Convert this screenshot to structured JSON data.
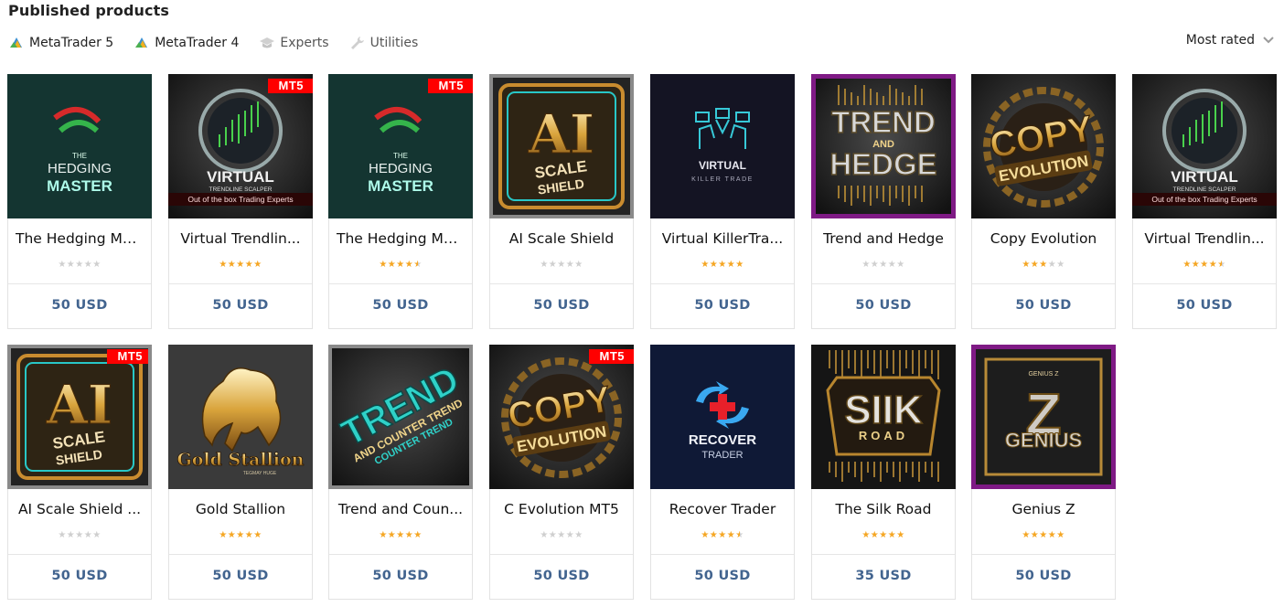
{
  "section_title": "Published products",
  "filters": [
    {
      "label": "MetaTrader 5",
      "icon": "metatrader-icon",
      "active": true
    },
    {
      "label": "MetaTrader 4",
      "icon": "metatrader-icon",
      "active": true
    },
    {
      "label": "Experts",
      "icon": "graduation-cap-icon",
      "active": false
    },
    {
      "label": "Utilities",
      "icon": "wrench-icon",
      "active": false
    }
  ],
  "sort": {
    "label": "Most rated"
  },
  "colors": {
    "price": "#42648f",
    "star_on": "#f5a623",
    "star_off": "#cfcfcf",
    "badge": "#ff0000",
    "purple_frame": "#7f1a85",
    "gray_frame": "#8a8a8a"
  },
  "products": [
    {
      "name": "The Hedging Ma...",
      "rating": 0,
      "price": "50 USD",
      "badge": "",
      "art": "hedging",
      "art_lines": [
        "THE",
        "HEDGING",
        "MASTER"
      ]
    },
    {
      "name": "Virtual Trendlin...",
      "rating": 5,
      "price": "50 USD",
      "badge": "MT5",
      "art": "virtual-trend",
      "art_lines": [
        "VIRTUAL",
        "TRENDLINE SCALPER",
        "Out of the box Trading Experts"
      ]
    },
    {
      "name": "The Hedging Ma...",
      "rating": 4.5,
      "price": "50 USD",
      "badge": "MT5",
      "art": "hedging",
      "art_lines": [
        "THE",
        "HEDGING",
        "MASTER"
      ]
    },
    {
      "name": "AI Scale Shield",
      "rating": 0,
      "price": "50 USD",
      "badge": "",
      "art": "ai-shield",
      "art_lines": [
        "AI",
        "SCALE",
        "SHIELD"
      ]
    },
    {
      "name": "Virtual KillerTra...",
      "rating": 5,
      "price": "50 USD",
      "badge": "",
      "art": "killer",
      "art_lines": [
        "VIRTUAL",
        "KILLER TRADE"
      ]
    },
    {
      "name": "Trend and Hedge",
      "rating": 0,
      "price": "50 USD",
      "badge": "",
      "art": "trend-hedge",
      "art_lines": [
        "TREND",
        "AND",
        "HEDGE"
      ]
    },
    {
      "name": "Copy Evolution",
      "rating": 3,
      "price": "50 USD",
      "badge": "",
      "art": "copy-evo",
      "art_lines": [
        "COPY",
        "EVOLUTION"
      ]
    },
    {
      "name": "Virtual Trendlin...",
      "rating": 4.5,
      "price": "50 USD",
      "badge": "",
      "art": "virtual-trend",
      "art_lines": [
        "VIRTUAL",
        "TRENDLINE SCALPER",
        "Out of the box Trading Experts"
      ]
    },
    {
      "name": "AI Scale Shield ...",
      "rating": 0,
      "price": "50 USD",
      "badge": "MT5",
      "art": "ai-shield",
      "art_lines": [
        "AI",
        "SCALE",
        "SHIELD"
      ]
    },
    {
      "name": "Gold Stallion",
      "rating": 5,
      "price": "50 USD",
      "badge": "",
      "art": "stallion",
      "art_lines": [
        "Gold Stallion",
        "TEGMAY HUGE"
      ]
    },
    {
      "name": "Trend and Coun...",
      "rating": 5,
      "price": "50 USD",
      "badge": "",
      "art": "trend-counter",
      "art_lines": [
        "TREND",
        "AND COUNTER TREND",
        "COUNTER TREND"
      ]
    },
    {
      "name": "C Evolution MT5",
      "rating": 0,
      "price": "50 USD",
      "badge": "MT5",
      "art": "copy-evo",
      "art_lines": [
        "COPY",
        "EVOLUTION"
      ]
    },
    {
      "name": "Recover Trader",
      "rating": 4.5,
      "price": "50 USD",
      "badge": "",
      "art": "recover",
      "art_lines": [
        "RECOVER",
        "TRADER"
      ]
    },
    {
      "name": "The Silk Road",
      "rating": 5,
      "price": "35 USD",
      "badge": "",
      "art": "silk",
      "art_lines": [
        "SIIK",
        "ROAD"
      ]
    },
    {
      "name": "Genius Z",
      "rating": 5,
      "price": "50 USD",
      "badge": "",
      "art": "genius",
      "art_lines": [
        "GENIUS Z",
        "Z",
        "GENIUS"
      ]
    }
  ]
}
